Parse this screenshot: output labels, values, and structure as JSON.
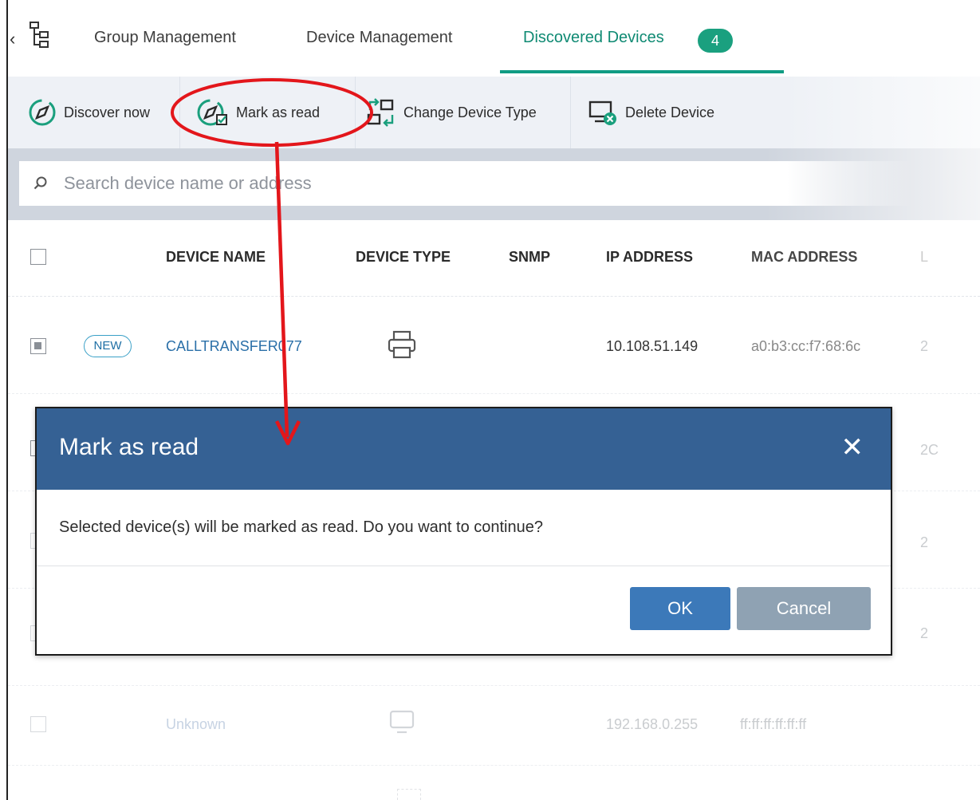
{
  "tabs": {
    "group_management": "Group Management",
    "device_management": "Device Management",
    "discovered_devices": "Discovered Devices",
    "discovered_count": "4",
    "back_glyph": "‹"
  },
  "toolbar": {
    "discover_now": "Discover now",
    "mark_as_read": "Mark as read",
    "change_device_type": "Change Device Type",
    "delete_device": "Delete Device"
  },
  "search": {
    "placeholder": "Search device name or address"
  },
  "table": {
    "headers": {
      "device_name": "DEVICE NAME",
      "device_type": "DEVICE TYPE",
      "snmp": "SNMP",
      "ip_address": "IP ADDRESS",
      "mac_address": "MAC ADDRESS",
      "extra": "L"
    },
    "rows": [
      {
        "badge": "NEW",
        "name": "CALLTRANSFER077",
        "ip": "10.108.51.149",
        "mac": "a0:b3:cc:f7:68:6c",
        "extra": "2",
        "type_icon": "printer-icon",
        "checked": true
      },
      {
        "extra": "2C"
      },
      {
        "extra": "2"
      },
      {
        "extra": "2"
      },
      {
        "name": "Unknown",
        "ip": "192.168.0.255",
        "mac": "ff:ff:ff:ff:ff:ff",
        "type_icon": "monitor-icon"
      }
    ]
  },
  "dialog": {
    "title": "Mark as read",
    "close_glyph": "✕",
    "message": "Selected device(s) will be marked as read. Do you want to continue?",
    "ok": "OK",
    "cancel": "Cancel"
  },
  "colors": {
    "accent_green": "#109c83",
    "dialog_header": "#356194",
    "ok_button": "#3c79b9",
    "cancel_button": "#8fa2b3",
    "annotation_red": "#e3161b"
  }
}
